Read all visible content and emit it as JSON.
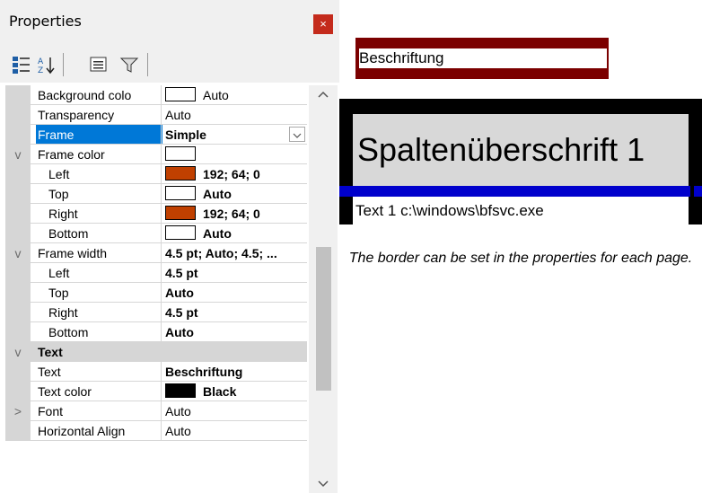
{
  "panel": {
    "title": "Properties",
    "close_glyph": "×"
  },
  "rows": [
    {
      "name": "Background colo",
      "value": "Auto",
      "swatch": "#ffffff",
      "indent": 1
    },
    {
      "name": "Transparency",
      "value": "Auto",
      "indent": 1
    },
    {
      "name": "Frame",
      "value": "Simple",
      "bold": true,
      "selected": true,
      "dropdown": true,
      "indent": 1
    },
    {
      "name": "Frame color",
      "value": "",
      "swatch": "#ffffff",
      "expander": "v",
      "indent": 1
    },
    {
      "name": "Left",
      "value": "192; 64; 0",
      "swatch": "#c04000",
      "bold": true,
      "indent": 2
    },
    {
      "name": "Top",
      "value": "Auto",
      "swatch": "#ffffff",
      "bold": true,
      "indent": 2
    },
    {
      "name": "Right",
      "value": "192; 64; 0",
      "swatch": "#c04000",
      "bold": true,
      "indent": 2
    },
    {
      "name": "Bottom",
      "value": "Auto",
      "swatch": "#ffffff",
      "bold": true,
      "indent": 2
    },
    {
      "name": "Frame width",
      "value": "4.5 pt; Auto; 4.5; ...",
      "bold": true,
      "expander": "v",
      "indent": 1
    },
    {
      "name": "Left",
      "value": "4.5 pt",
      "bold": true,
      "indent": 2
    },
    {
      "name": "Top",
      "value": "Auto",
      "bold": true,
      "indent": 2
    },
    {
      "name": "Right",
      "value": "4.5 pt",
      "bold": true,
      "indent": 2
    },
    {
      "name": "Bottom",
      "value": "Auto",
      "bold": true,
      "indent": 2
    },
    {
      "name": "Text",
      "category": true,
      "expander": "v",
      "indent": 1
    },
    {
      "name": "Text",
      "value": "Beschriftung",
      "bold": true,
      "indent": 1
    },
    {
      "name": "Text color",
      "value": "Black",
      "swatch": "#000000",
      "bold": true,
      "indent": 1
    },
    {
      "name": "Font",
      "value": "Auto",
      "expander": ">",
      "indent": 1
    },
    {
      "name": "Horizontal Align",
      "value": "Auto",
      "indent": 1
    }
  ],
  "preview": {
    "caption": "Beschriftung",
    "column_header": "Spaltenüberschrift 1",
    "cell_text": "Text 1 c:\\windows\\bfsvc.exe",
    "note": "The border can be set in the properties for each page."
  },
  "colors": {
    "selection": "#0078d7",
    "frame_color": "#c04000",
    "caption_border": "#7b0000",
    "header_underline": "#0000cc"
  }
}
